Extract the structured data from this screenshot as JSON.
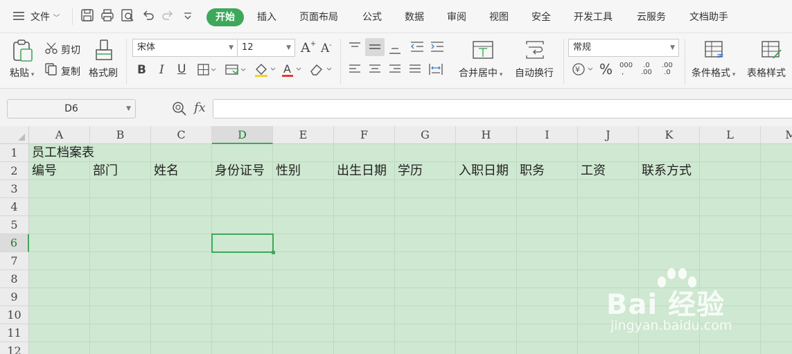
{
  "menu": {
    "file": "文件",
    "tabs": [
      "开始",
      "插入",
      "页面布局",
      "公式",
      "数据",
      "审阅",
      "视图",
      "安全",
      "开发工具",
      "云服务",
      "文档助手"
    ],
    "active_tab": "开始"
  },
  "ribbon": {
    "paste": "粘贴",
    "cut": "剪切",
    "copy": "复制",
    "format_painter": "格式刷",
    "font_name": "宋体",
    "font_size": "12",
    "merge_center": "合并居中",
    "wrap_text": "自动换行",
    "number_format": "常规",
    "conditional_format": "条件格式",
    "table_style": "表格样式"
  },
  "formula_bar": {
    "name_box": "D6",
    "fx": "fx",
    "content": ""
  },
  "sheet": {
    "columns": [
      "A",
      "B",
      "C",
      "D",
      "E",
      "F",
      "G",
      "H",
      "I",
      "J",
      "K",
      "L",
      "M"
    ],
    "rows": [
      "1",
      "2",
      "3",
      "4",
      "5",
      "6",
      "7",
      "8",
      "9",
      "10",
      "11",
      "12"
    ],
    "active_column": "D",
    "active_row": "6",
    "title": "员工档案表",
    "headers": [
      "编号",
      "部门",
      "姓名",
      "身份证号",
      "性别",
      "出生日期",
      "学历",
      "入职日期",
      "职务",
      "工资",
      "联系方式"
    ]
  },
  "watermark": {
    "brand": "Bai 经验",
    "url": "jingyan.baidu.com"
  },
  "colors": {
    "accent": "#3ea85a",
    "cell_bg": "#cfe8d1"
  }
}
